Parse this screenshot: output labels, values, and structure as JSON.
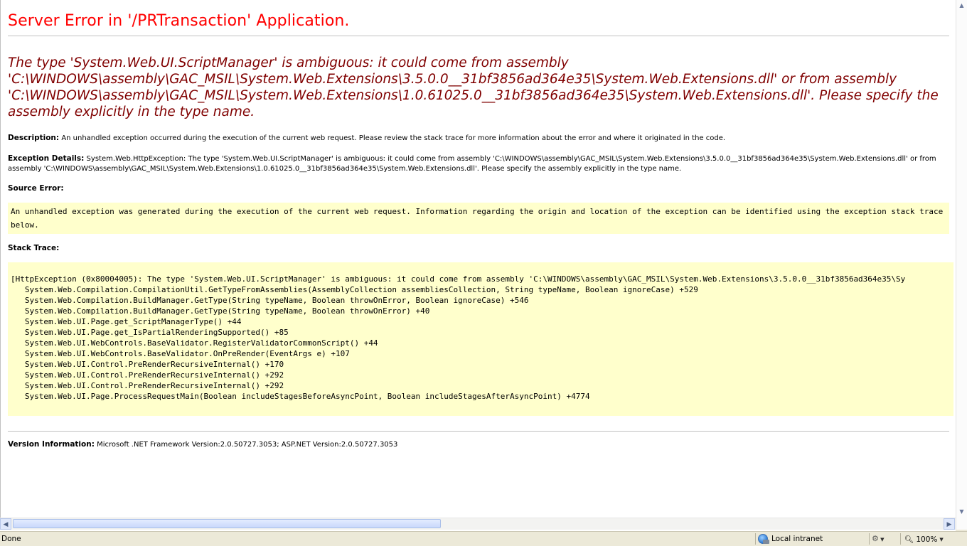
{
  "page": {
    "title": "Server Error in '/PRTransaction' Application.",
    "error_message": "The type 'System.Web.UI.ScriptManager' is ambiguous: it could come from assembly 'C:\\WINDOWS\\assembly\\GAC_MSIL\\System.Web.Extensions\\3.5.0.0__31bf3856ad364e35\\System.Web.Extensions.dll' or from assembly 'C:\\WINDOWS\\assembly\\GAC_MSIL\\System.Web.Extensions\\1.0.61025.0__31bf3856ad364e35\\System.Web.Extensions.dll'. Please specify the assembly explicitly in the type name.",
    "description_label": "Description:",
    "description_text": "An unhandled exception occurred during the execution of the current web request. Please review the stack trace for more information about the error and where it originated in the code.",
    "exception_label": "Exception Details:",
    "exception_text": "System.Web.HttpException: The type 'System.Web.UI.ScriptManager' is ambiguous: it could come from assembly 'C:\\WINDOWS\\assembly\\GAC_MSIL\\System.Web.Extensions\\3.5.0.0__31bf3856ad364e35\\System.Web.Extensions.dll' or from assembly 'C:\\WINDOWS\\assembly\\GAC_MSIL\\System.Web.Extensions\\1.0.61025.0__31bf3856ad364e35\\System.Web.Extensions.dll'. Please specify the assembly explicitly in the type name.",
    "source_error_label": "Source Error:",
    "source_error_text": "An unhandled exception was generated during the execution of the current web request. Information regarding the origin and location of the exception can be identified using the exception stack trace below.",
    "stack_trace_label": "Stack Trace:",
    "stack_trace": "[HttpException (0x80004005): The type 'System.Web.UI.ScriptManager' is ambiguous: it could come from assembly 'C:\\WINDOWS\\assembly\\GAC_MSIL\\System.Web.Extensions\\3.5.0.0__31bf3856ad364e35\\Sy\n   System.Web.Compilation.CompilationUtil.GetTypeFromAssemblies(AssemblyCollection assembliesCollection, String typeName, Boolean ignoreCase) +529\n   System.Web.Compilation.BuildManager.GetType(String typeName, Boolean throwOnError, Boolean ignoreCase) +546\n   System.Web.Compilation.BuildManager.GetType(String typeName, Boolean throwOnError) +40\n   System.Web.UI.Page.get_ScriptManagerType() +44\n   System.Web.UI.Page.get_IsPartialRenderingSupported() +85\n   System.Web.UI.WebControls.BaseValidator.RegisterValidatorCommonScript() +44\n   System.Web.UI.WebControls.BaseValidator.OnPreRender(EventArgs e) +107\n   System.Web.UI.Control.PreRenderRecursiveInternal() +170\n   System.Web.UI.Control.PreRenderRecursiveInternal() +292\n   System.Web.UI.Control.PreRenderRecursiveInternal() +292\n   System.Web.UI.Page.ProcessRequestMain(Boolean includeStagesBeforeAsyncPoint, Boolean includeStagesAfterAsyncPoint) +4774",
    "version_label": "Version Information:",
    "version_text": "Microsoft .NET Framework Version:2.0.50727.3053; ASP.NET Version:2.0.50727.3053"
  },
  "colors": {
    "title": "#ff0000",
    "error_message": "#800000",
    "code_background": "#ffffcc"
  },
  "status_bar": {
    "status_text": "Done",
    "zone_icon": "globe-icon",
    "zone_text": "Local intranet",
    "protected_mode_icon": "protected-mode-icon",
    "zoom_icon": "magnifier-icon",
    "zoom_text": "100%"
  },
  "scrollbars": {
    "horizontal_thumb_fraction": 0.46
  }
}
